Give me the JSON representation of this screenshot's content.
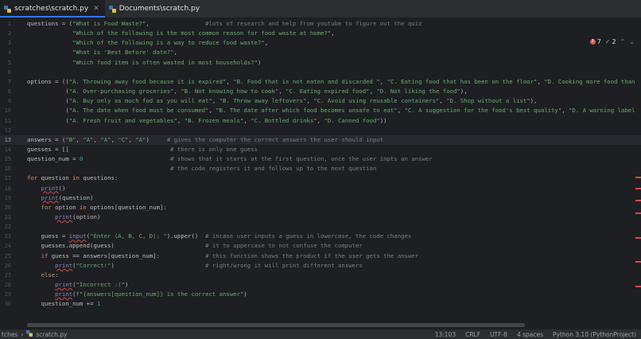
{
  "tabs": [
    {
      "label": "scratches\\scratch.py",
      "active": true
    },
    {
      "label": "Documents\\scratch.py",
      "active": false
    }
  ],
  "inspections": {
    "errors": "7",
    "warnings": "2"
  },
  "editor": {
    "current_line": 13,
    "line_numbers": [
      "1",
      "2",
      "3",
      "4",
      "5",
      "6",
      "7",
      "8",
      "9",
      "10",
      "11",
      "12",
      "13",
      "14",
      "15",
      "16",
      "17",
      "18",
      "19",
      "20",
      "21",
      "22",
      "23",
      "24",
      "25",
      "26",
      "27",
      "28",
      "29",
      "30"
    ],
    "lines": [
      "questions = (\"What is Food Waste?\",                #lots of research and help from youtube to figure out the quiz",
      "             \"Which of the following is the most common reason for food waste at home?\",",
      "             \"Which of the following is a way to reduce food waste?\",",
      "             \"What is 'Best Before' date?\",",
      "             \"Which food item is often wasted in most households?\")",
      "",
      "options = ((\"A. Throwing away food because it is expired\", \"B. Food that is not eaten and discarded \", \"C. Eating food that has been on the floor\", \"D. Cooking more food than",
      "           (\"A. Over-purchasing groceries\", \"B. Not knowing how to cook\", \"C. Eating expired food\", \"D. Not liking the food\"),",
      "           (\"A. Buy only as much fod as you will eat\", \"B. Throw away leftovers\", \"C. Avoid using reusable containers\", \"D. Shop without a list\"),",
      "           (\"A. The date when food must be consumed\", \"B. The date after which food becomes unsafe to eat\", \"C. A suggestion for the food's best quality\", \"D. A warning label",
      "           (\"A. Fresh fruit and vegetables\", \"B. Frozen meals\", \"C. Bottled drinks\", \"D. Canned food\"))",
      "",
      "answers = (\"B\", \"A\", \"A\", \"C\", \"A\")     # gives the computer the correct answers the user should input",
      "guesses = []                             # there is only one guess",
      "question_num = 0                         # shows that it starts at the first question, once the user inpts an answer",
      "                                         # the code registers it and follows up to the next question",
      "for question in questions:",
      "    print()",
      "    print(question)",
      "    for option in options[question_num]:",
      "        print(option)",
      "",
      "    guess = input(\"Enter (A, B, C, D): \").upper()  # incase user inputs a guess in lowercase, the code changes",
      "    guesses.append(guess)                          # it to uppercase to not confuse the computer",
      "    if guess == answers[question_num]:             # this function shows the product if the user gets the answer",
      "        print(\"Correct!\")                          # right/wrong it will print different answers",
      "    else:",
      "        print(\"Incorrect :(\")",
      "        print(f\"{answers[question_num]} is the correct answer\")",
      "    question_num += 1"
    ]
  },
  "status": {
    "project": "tches",
    "file": "scratch.py",
    "position": "13:103",
    "line_ending": "CRLF",
    "encoding": "UTF-8",
    "indent": "4 spaces",
    "interpreter": "Python 3.10 (PythonProject)"
  },
  "colors": {
    "background": "#1e1f22",
    "keyword": "#cf8e6d",
    "string": "#6aab73",
    "comment": "#7a7e85",
    "number": "#2aacb8",
    "accent": "#3574f0",
    "error": "#db5c5c"
  },
  "icons": [
    "python-file-icon",
    "close-icon",
    "error-icon",
    "warning-icon",
    "chevron-up-icon",
    "chevron-down-icon"
  ]
}
